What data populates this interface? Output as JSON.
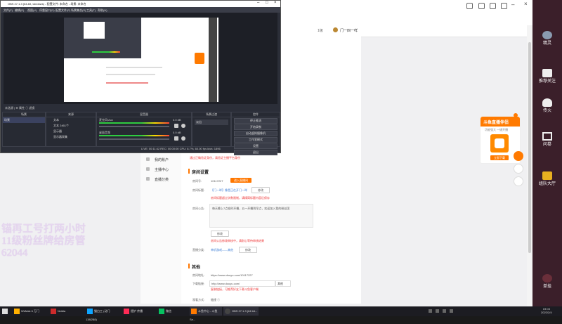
{
  "obs": {
    "title": "OBS 27.1.3 (64-bit, windows) - 配置文件: 未命名 - 场景: 未命名",
    "menu": [
      "文件(F)",
      "编辑(E)",
      "视图(V)",
      "停靠窗口(D)",
      "配置文件(P)",
      "场景集合(S)",
      "工具(T)",
      "帮助(H)"
    ],
    "status_line": "未选源 | ⚙ 属性  ⓘ 滤镜",
    "scenes_header": "场景",
    "scene_item": "场景",
    "sources_header": "来源",
    "sources": [
      "文本",
      "文本 2461个",
      "显示器",
      "显示器采集"
    ],
    "mixer_header": "混音器",
    "mixer_tracks": [
      {
        "name": "麦克风/Aux",
        "db": "0.0 dB"
      },
      {
        "name": "桌面音频",
        "db": "0.0 dB"
      }
    ],
    "transitions_header": "场景过渡",
    "transition_value": "淡出",
    "controls_header": "控件",
    "controls": [
      "停止推流",
      "开始录制",
      "启动虚拟摄像机",
      "工作室模式",
      "设置",
      "退出"
    ],
    "statusbar": "LIVE: 00:11:42  REC: 00:00:00  CPU: 8.7%, 60.00 fps  kb/s: 1896"
  },
  "douyu": {
    "top_links": [
      "1级",
      "门一四一咩"
    ],
    "sidebar": [
      "我的账户",
      "主播中心",
      "直播分类"
    ],
    "red_notice_1": "通过正确验证身份，请验证主播平台身份",
    "section_title": "房间设置",
    "room_id_label": "房间号:",
    "room_id_value": "10117227",
    "room_id_btn": "进入直播间",
    "room_title_label": "房间标题:",
    "room_title_value": "【门一咩】像是正在开门一咩",
    "room_title_btn": "修改",
    "room_title_note": "房间标题超过字数限制，请精简标题内容后保存",
    "room_notice_label": "房间公告:",
    "room_notice_value": "每天晚上7点准时开播，五一开播到早点，欢迎加入我的粉丝团",
    "room_notice_btn": "修改",
    "room_notice_note": "房间公告修改审核中，请耐心等待审核结果",
    "category_label": "直播分类:",
    "category_value": "单机游戏——其他",
    "category_btn": "修改",
    "other_title": "其他",
    "url_label": "房间地址:",
    "url_value": "https://www.douyu.com/10117227",
    "dl_label": "下载链接:",
    "dl_value": "http://www.douyu.com/",
    "dl_option": "其他",
    "dl_note": "复制链接，可推荐好友下载斗鱼客户端",
    "watch_label": "观看方式:",
    "watch_value": "链接 ⓘ",
    "top_search": "Sent"
  },
  "promo": {
    "title": "斗鱼直播伴侣",
    "subtitle": "功能强大 一键开播",
    "btn": "立即下载"
  },
  "overlay_lines": [
    "锚再工号打两小时",
    "11级粉丝牌给房管",
    "62044"
  ],
  "rightbar": [
    {
      "label": "精灵",
      "icon": "app-icon"
    },
    {
      "label": "推荐关注",
      "icon": "camera-icon"
    },
    {
      "label": "传火",
      "icon": "flame-icon"
    },
    {
      "label": "问卷",
      "icon": "survey-icon"
    },
    {
      "label": "组队大厅",
      "icon": "team-icon"
    },
    {
      "label": "单挂",
      "icon": "game-icon"
    }
  ],
  "taskbar": [
    {
      "label": "WeMak 6 万门",
      "color": "#ffb000"
    },
    {
      "label": "Nvidia",
      "color": "#cc2b2b"
    },
    {
      "label": "猫白工 (动门138/288)",
      "color": "#0ea5ff"
    },
    {
      "label": "提护 传播",
      "color": "#ff2b55"
    },
    {
      "label": "微信",
      "color": "#07c160"
    },
    {
      "label": "斗鱼中心 - 斗鱼 Se...",
      "color": "#ff7a00"
    },
    {
      "label": "OBS 27.1.3 (64 bit...",
      "color": "#444"
    }
  ],
  "clock": {
    "time": "19:03",
    "date": "2022/2/4"
  },
  "colors": {
    "accent": "#ff7700",
    "warn": "#e33333",
    "obs_bg": "#2b2e38"
  }
}
